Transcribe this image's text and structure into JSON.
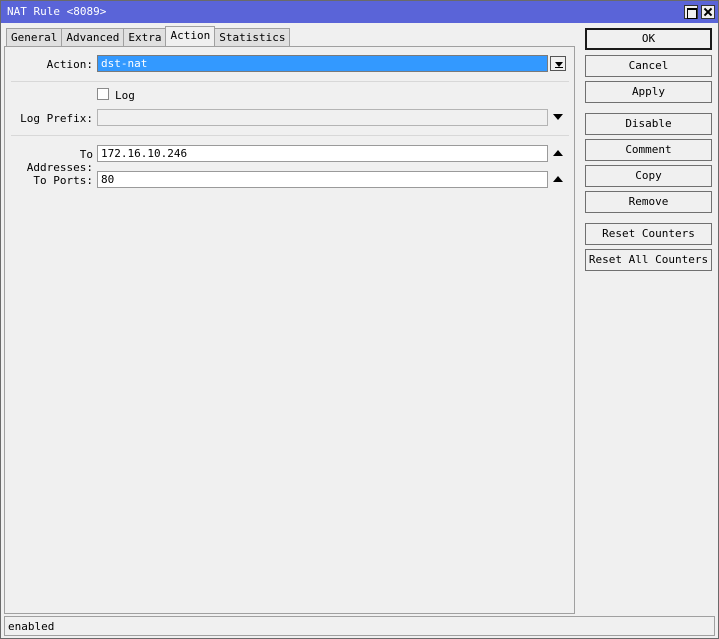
{
  "window": {
    "title": "NAT Rule <8089>"
  },
  "tabs": [
    {
      "label": "General"
    },
    {
      "label": "Advanced"
    },
    {
      "label": "Extra"
    },
    {
      "label": "Action"
    },
    {
      "label": "Statistics"
    }
  ],
  "active_tab": "Action",
  "form": {
    "action_label": "Action:",
    "action_value": "dst-nat",
    "log_label": "Log",
    "log_checked": false,
    "log_prefix_label": "Log Prefix:",
    "log_prefix_value": "",
    "to_addresses_label": "To Addresses:",
    "to_addresses_value": "172.16.10.246",
    "to_ports_label": "To Ports:",
    "to_ports_value": "80"
  },
  "buttons": {
    "ok": "OK",
    "cancel": "Cancel",
    "apply": "Apply",
    "disable": "Disable",
    "comment": "Comment",
    "copy": "Copy",
    "remove": "Remove",
    "reset_counters": "Reset Counters",
    "reset_all_counters": "Reset All Counters"
  },
  "status": {
    "text": "enabled"
  },
  "colors": {
    "titlebar": "#5a64d8",
    "selection": "#3399ff",
    "background": "#f0f0f0"
  }
}
